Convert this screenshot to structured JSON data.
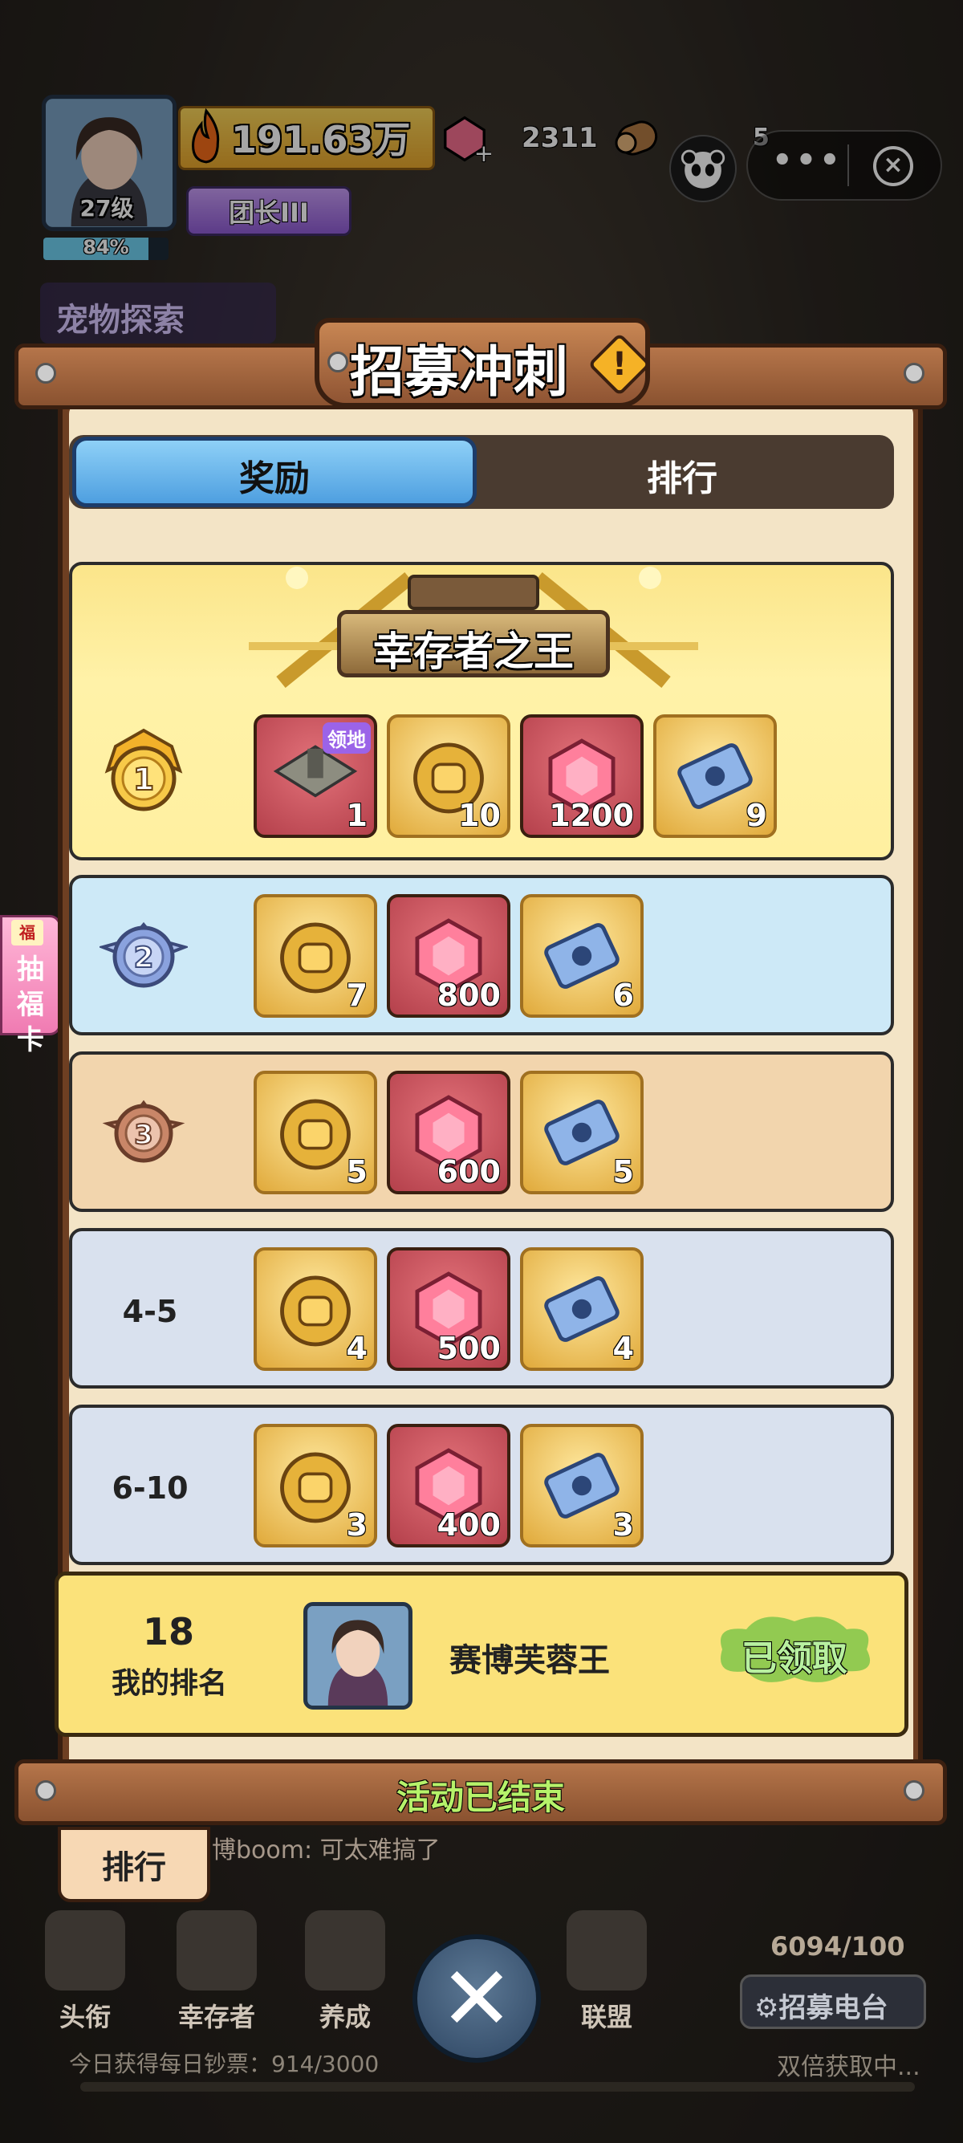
{
  "hud": {
    "level": "27级",
    "xp_percent": 84,
    "xp_text": "84%",
    "power": "191.63万",
    "title_rank": "团长III",
    "gems": "2311",
    "wood_count": "5"
  },
  "background": {
    "explore_label": "宠物探索",
    "fu_card_tag": "福",
    "fu_card_label": "抽福卡"
  },
  "modal": {
    "title": "招募冲刺",
    "tabs": [
      {
        "label": "奖励",
        "active": true
      },
      {
        "label": "排行",
        "active": false
      }
    ],
    "king_title": "幸存者之王",
    "land_tag": "领地",
    "tiers": [
      {
        "rank": "1",
        "rewards": [
          {
            "icon": "territory-icon",
            "count": "1"
          },
          {
            "icon": "recruit-medal-icon",
            "count": "10"
          },
          {
            "icon": "gem-icon",
            "count": "1200"
          },
          {
            "icon": "pet-ticket-icon",
            "count": "9"
          }
        ]
      },
      {
        "rank": "2",
        "rewards": [
          {
            "icon": "recruit-medal-icon",
            "count": "7"
          },
          {
            "icon": "gem-icon",
            "count": "800"
          },
          {
            "icon": "pet-ticket-icon",
            "count": "6"
          }
        ]
      },
      {
        "rank": "3",
        "rewards": [
          {
            "icon": "recruit-medal-icon",
            "count": "5"
          },
          {
            "icon": "gem-icon",
            "count": "600"
          },
          {
            "icon": "pet-ticket-icon",
            "count": "5"
          }
        ]
      },
      {
        "rank": "4-5",
        "rewards": [
          {
            "icon": "recruit-medal-icon",
            "count": "4"
          },
          {
            "icon": "gem-icon",
            "count": "500"
          },
          {
            "icon": "pet-ticket-icon",
            "count": "4"
          }
        ]
      },
      {
        "rank": "6-10",
        "rewards": [
          {
            "icon": "recruit-medal-icon",
            "count": "3"
          },
          {
            "icon": "gem-icon",
            "count": "400"
          },
          {
            "icon": "pet-ticket-icon",
            "count": "3"
          }
        ]
      }
    ],
    "my_rank": {
      "number": "18",
      "label": "我的排名",
      "name": "赛博芙蓉王",
      "status": "已领取"
    },
    "footer": "活动已结束"
  },
  "bottom": {
    "rank_tab": "排行",
    "chat_user": "博boom:",
    "chat_msg": "可太难搞了",
    "nav": [
      "头衔",
      "幸存者",
      "养成",
      "联盟"
    ],
    "stock": "6094/100",
    "recruit_station": "招募电台",
    "daily_cash": "今日获得每日钞票：914/3000",
    "double_status": "双倍获取中..."
  },
  "colors": {
    "tab_active": "#4e9fe0",
    "gold_tier": "#fff0a0",
    "silver_tier": "#cde9f7",
    "bronze_tier": "#f2d5ad",
    "plain_tier": "#d9e1ee",
    "ended_text": "#b6f26a"
  }
}
